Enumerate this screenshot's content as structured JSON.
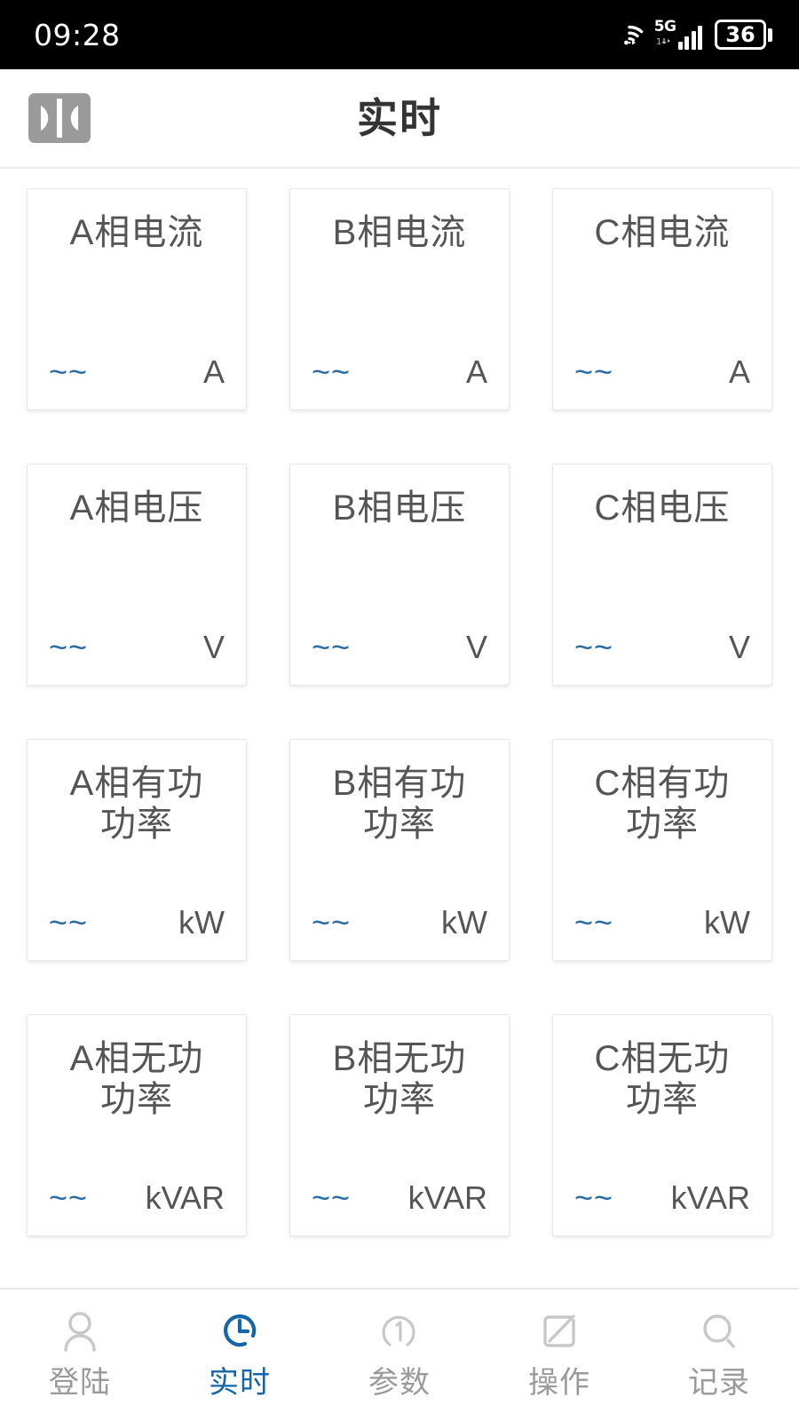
{
  "status_bar": {
    "time": "09:28",
    "network_label": "5G",
    "battery_level": "36",
    "wifi_icon": "wifi-icon",
    "signal_icon": "signal-bars-icon",
    "battery_icon": "battery-icon"
  },
  "header": {
    "logo_icon": "app-logo-icon",
    "title": "实时"
  },
  "cards": [
    {
      "title": "A相电流",
      "value": "~~",
      "unit": "A"
    },
    {
      "title": "B相电流",
      "value": "~~",
      "unit": "A"
    },
    {
      "title": "C相电流",
      "value": "~~",
      "unit": "A"
    },
    {
      "title": "A相电压",
      "value": "~~",
      "unit": "V"
    },
    {
      "title": "B相电压",
      "value": "~~",
      "unit": "V"
    },
    {
      "title": "C相电压",
      "value": "~~",
      "unit": "V"
    },
    {
      "title": "A相有功\n功率",
      "value": "~~",
      "unit": "kW"
    },
    {
      "title": "B相有功\n功率",
      "value": "~~",
      "unit": "kW"
    },
    {
      "title": "C相有功\n功率",
      "value": "~~",
      "unit": "kW"
    },
    {
      "title": "A相无功\n功率",
      "value": "~~",
      "unit": "kVAR"
    },
    {
      "title": "B相无功\n功率",
      "value": "~~",
      "unit": "kVAR"
    },
    {
      "title": "C相无功\n功率",
      "value": "~~",
      "unit": "kVAR"
    }
  ],
  "bottom_nav": {
    "items": [
      {
        "label": "登陆",
        "icon": "person-icon",
        "active": false
      },
      {
        "label": "实时",
        "icon": "clock-icon",
        "active": true
      },
      {
        "label": "参数",
        "icon": "circle-one-icon",
        "active": false
      },
      {
        "label": "操作",
        "icon": "edit-square-icon",
        "active": false
      },
      {
        "label": "记录",
        "icon": "search-icon",
        "active": false
      }
    ]
  },
  "colors": {
    "accent": "#1565a8",
    "value_blue": "#2b6ca3",
    "text_gray": "#555555",
    "inactive_gray": "#c8c8c8",
    "label_gray": "#9a9a9a",
    "status_bar_bg": "#000000",
    "card_border": "#e7e7e7"
  }
}
